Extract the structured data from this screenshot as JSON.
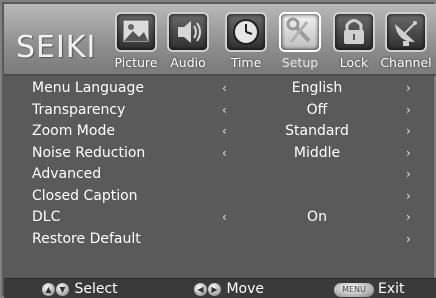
{
  "brand": "SEIKI",
  "tabs": [
    {
      "label": "Picture",
      "icon": "picture-icon",
      "active": false
    },
    {
      "label": "Audio",
      "icon": "audio-icon",
      "active": false
    },
    {
      "label": "Time",
      "icon": "clock-icon",
      "active": false
    },
    {
      "label": "Setup",
      "icon": "setup-icon",
      "active": true
    },
    {
      "label": "Lock",
      "icon": "padlock-icon",
      "active": false
    },
    {
      "label": "Channel",
      "icon": "satellite-dish-icon",
      "active": false
    }
  ],
  "rows": [
    {
      "label": "Menu Language",
      "value": "English",
      "left_arrow": "‹",
      "right_arrow": "›"
    },
    {
      "label": "Transparency",
      "value": "Off",
      "left_arrow": "‹",
      "right_arrow": "›"
    },
    {
      "label": "Zoom Mode",
      "value": "Standard",
      "left_arrow": "‹",
      "right_arrow": "›"
    },
    {
      "label": "Noise Reduction",
      "value": "Middle",
      "left_arrow": "‹",
      "right_arrow": "›"
    },
    {
      "label": "Advanced",
      "value": "",
      "left_arrow": "",
      "right_arrow": "›"
    },
    {
      "label": "Closed Caption",
      "value": "",
      "left_arrow": "",
      "right_arrow": "›"
    },
    {
      "label": "DLC",
      "value": "On",
      "left_arrow": "‹",
      "right_arrow": "›"
    },
    {
      "label": "Restore Default",
      "value": "",
      "left_arrow": "",
      "right_arrow": "›"
    }
  ],
  "footer": {
    "select_label": "Select",
    "move_label": "Move",
    "menu_button_text": "MENU",
    "exit_label": "Exit",
    "up_glyph": "▲",
    "down_glyph": "▼",
    "left_glyph": "◀",
    "right_glyph": "▶"
  },
  "colors": {
    "background": "#5a5a5a",
    "header_gradient_top": "#b9b9b9",
    "footer_bar": "#3a3a3a",
    "text": "#ffffff"
  }
}
